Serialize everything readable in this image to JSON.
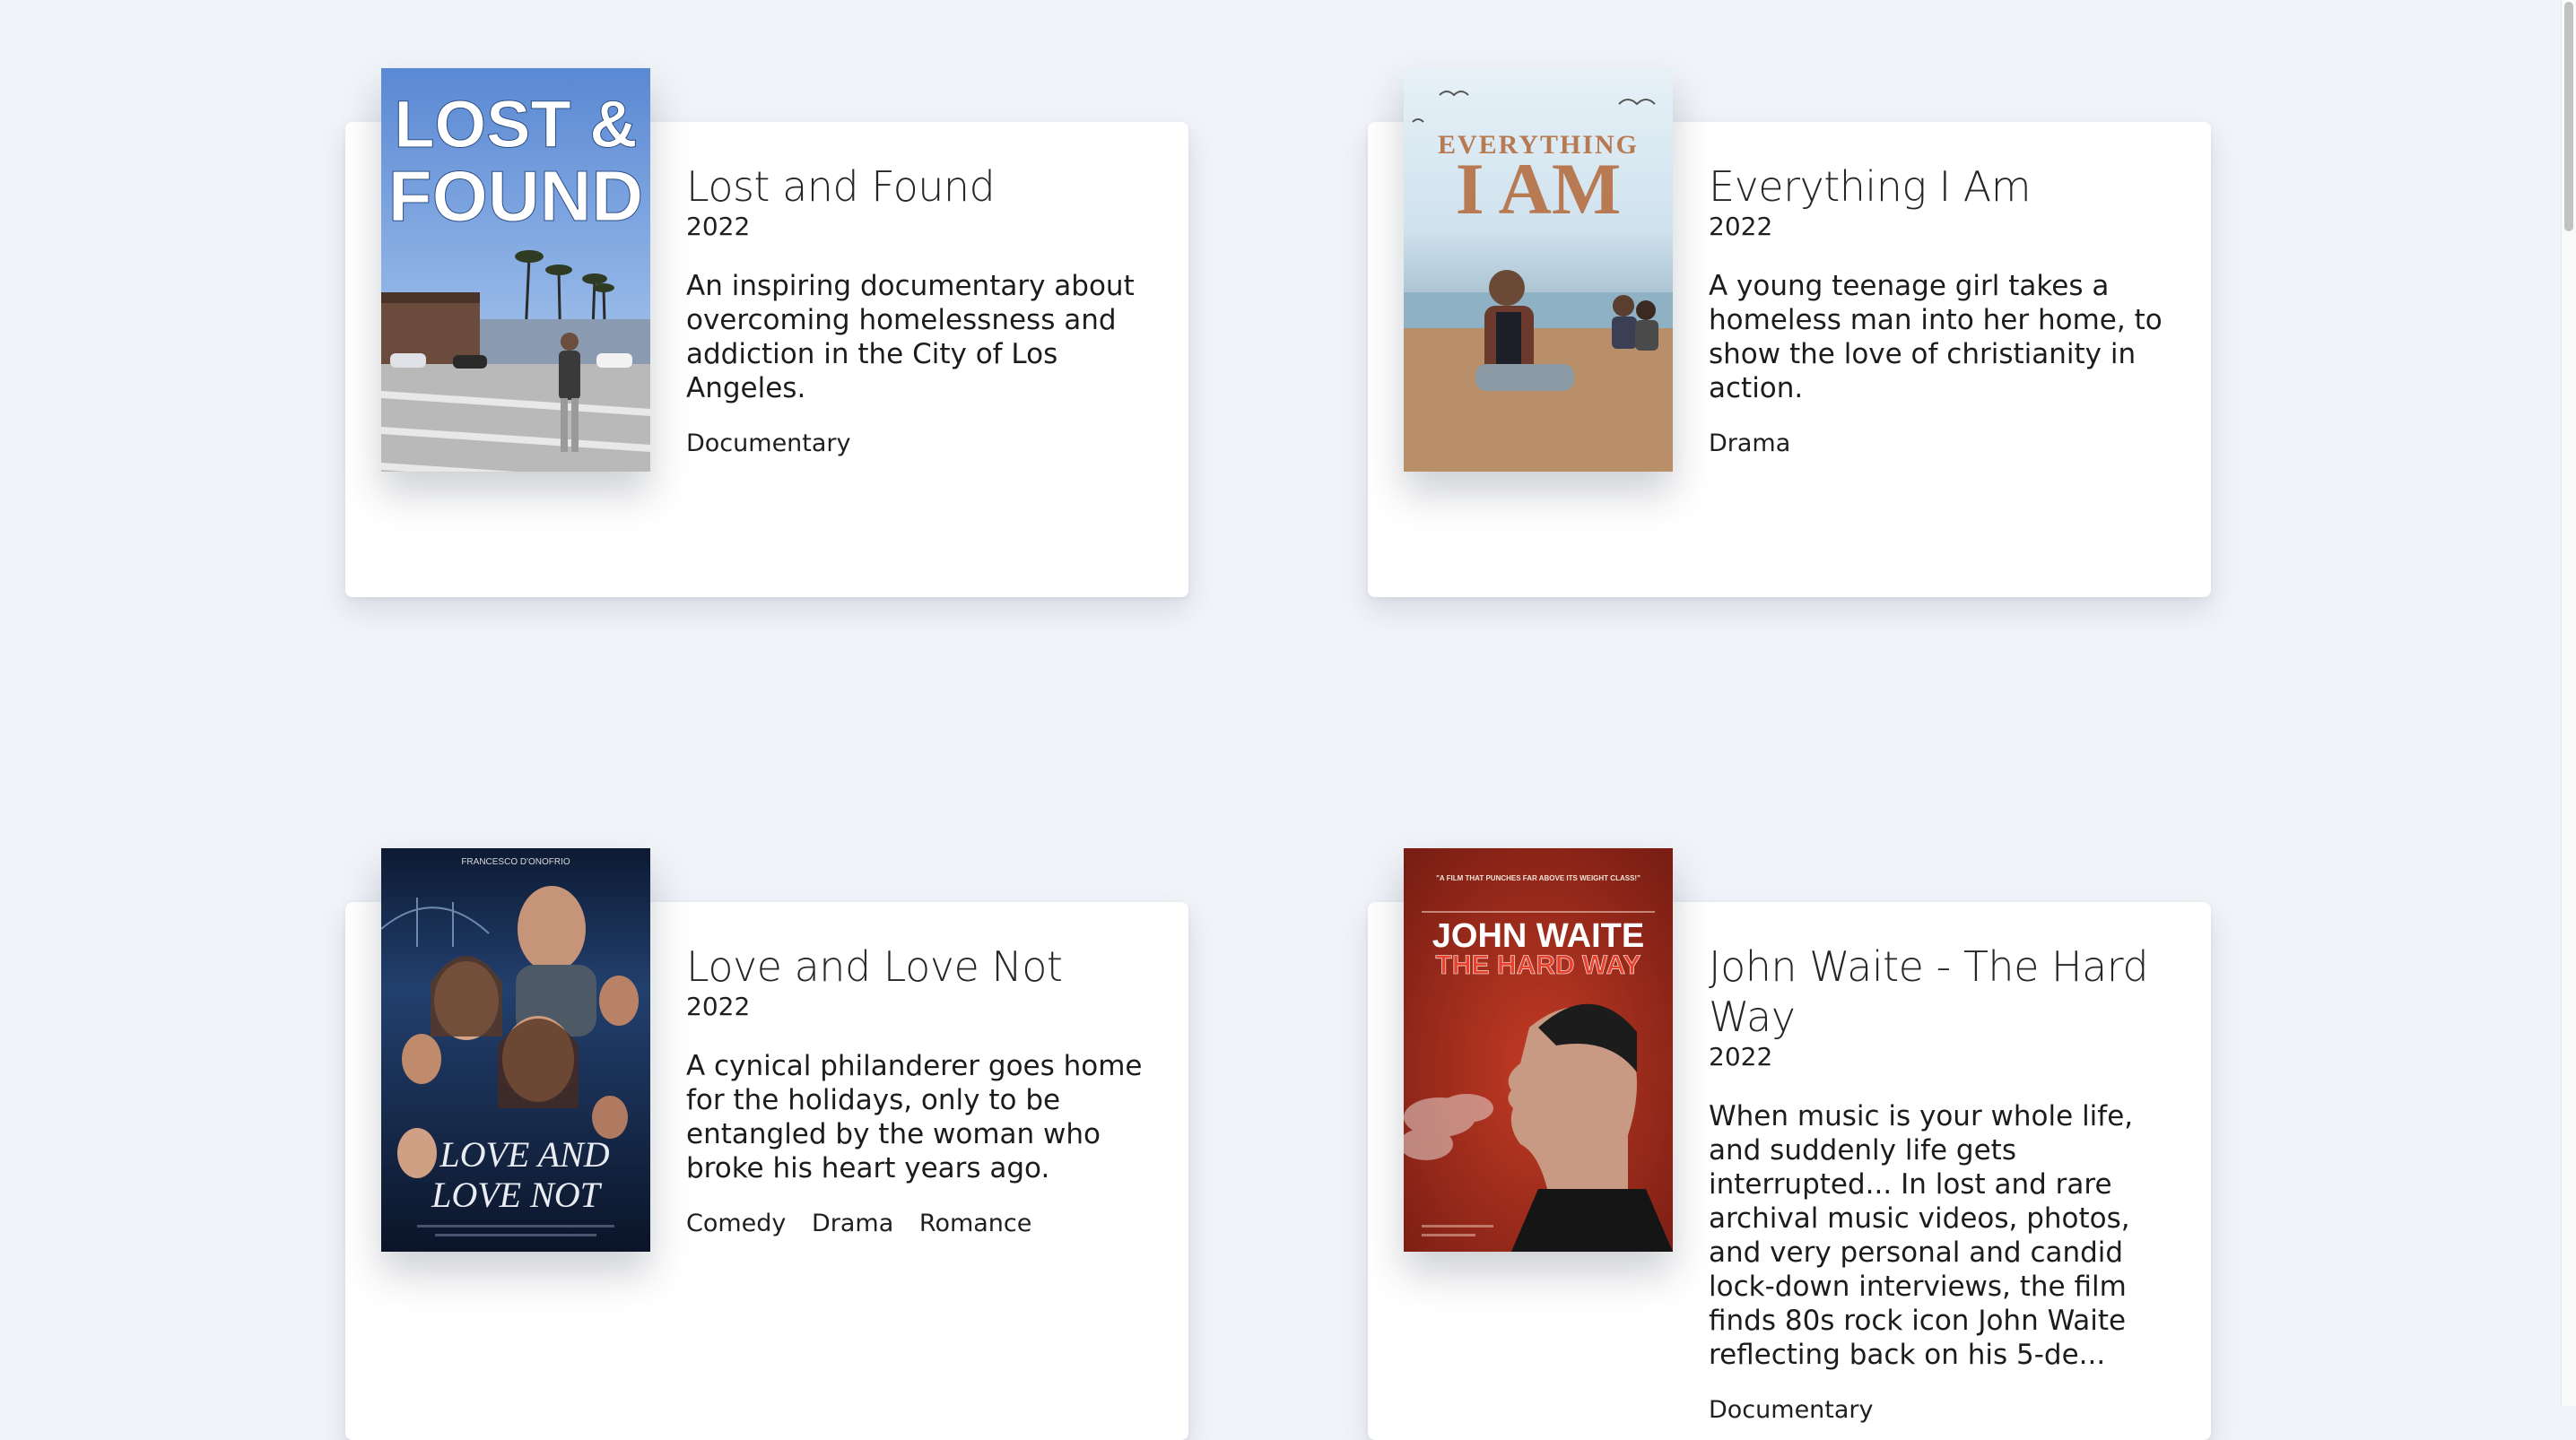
{
  "movies": [
    {
      "title": "Lost and Found",
      "year": "2022",
      "description": "An inspiring documentary about overcoming homelessness and addiction in the City of Los Angeles.",
      "genres": [
        "Documentary"
      ],
      "poster": {
        "line1": "LOST &",
        "line2": "FOUND",
        "palette": [
          "#5f8ed6",
          "#9bb9e6"
        ]
      }
    },
    {
      "title": "Everything I Am",
      "year": "2022",
      "description": "A young teenage girl takes a homeless man into her home, to show the love of christianity in action.",
      "genres": [
        "Drama"
      ],
      "poster": {
        "line1": "EVERYTHING",
        "line2": "I AM",
        "palette": [
          "#dfeef6",
          "#b98a63"
        ]
      }
    },
    {
      "title": "Love and Love Not",
      "year": "2022",
      "description": "A cynical philanderer goes home for the holidays, only to be entangled by the woman who broke his heart years ago.",
      "genres": [
        "Comedy",
        "Drama",
        "Romance"
      ],
      "poster": {
        "line1": "LOVE AND",
        "line2": "LOVE NOT",
        "top_text": "FRANCESCO D'ONOFRIO",
        "palette": [
          "#0f1d38",
          "#2b4a7c"
        ]
      }
    },
    {
      "title": "John Waite - The Hard Way",
      "year": "2022",
      "description": "When music is your whole life, and suddenly life gets interrupted... In lost and rare archival music videos, photos, and very personal and candid lock-down interviews, the film finds 80s rock icon John Waite reflecting back on his 5-de...",
      "genres": [
        "Documentary"
      ],
      "poster": {
        "line1": "JOHN WAITE",
        "line2": "THE HARD WAY",
        "tagline": "\"A FILM THAT PUNCHES FAR ABOVE ITS WEIGHT CLASS!\"",
        "palette": [
          "#8e2418",
          "#c5361f"
        ]
      }
    }
  ],
  "colors": {
    "background": "#f0f3f8",
    "card": "#ffffff",
    "text": "#1f1f1f"
  }
}
